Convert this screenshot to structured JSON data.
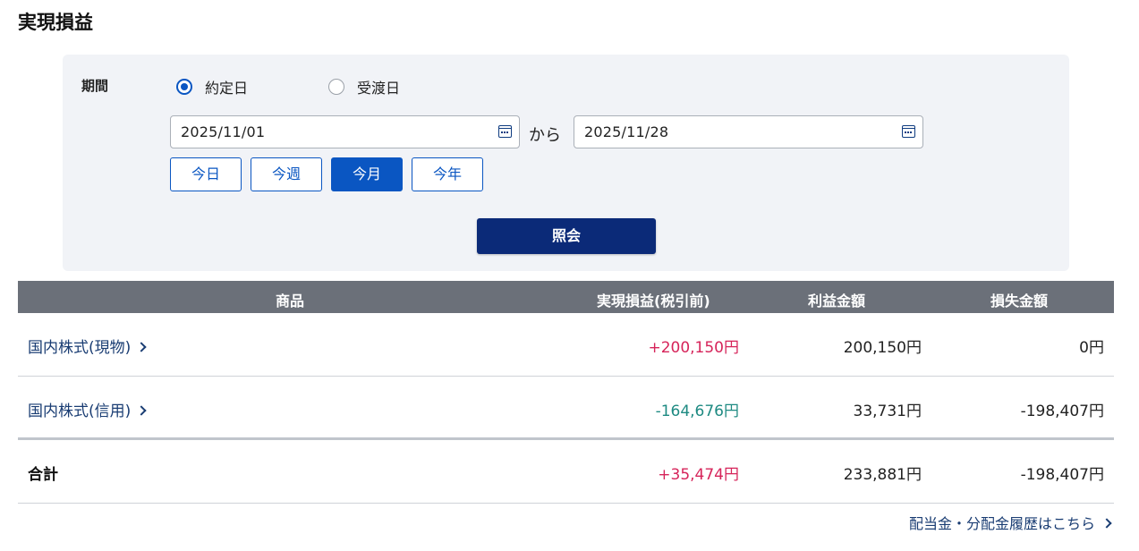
{
  "page": {
    "title": "実現損益"
  },
  "filter": {
    "period_label": "期間",
    "radios": [
      {
        "label": "約定日",
        "checked": true
      },
      {
        "label": "受渡日",
        "checked": false
      }
    ],
    "date_from": "2025/11/01",
    "date_to": "2025/11/28",
    "connector": "から",
    "quick_buttons": [
      {
        "label": "今日",
        "active": false
      },
      {
        "label": "今週",
        "active": false
      },
      {
        "label": "今月",
        "active": true
      },
      {
        "label": "今年",
        "active": false
      }
    ],
    "submit_label": "照会"
  },
  "table": {
    "headers": {
      "product": "商品",
      "pnl": "実現損益(税引前)",
      "profit": "利益金額",
      "loss": "損失金額"
    },
    "rows": [
      {
        "product": "国内株式(現物)",
        "pnl": "+200,150円",
        "profit": "200,150円",
        "loss": "0円"
      },
      {
        "product": "国内株式(信用)",
        "pnl": "-164,676円",
        "profit": "33,731円",
        "loss": "-198,407円"
      }
    ],
    "total": {
      "label": "合計",
      "pnl": "+35,474円",
      "profit": "233,881円",
      "loss": "-198,407円"
    }
  },
  "footer": {
    "link_label": "配当金・分配金履歴はこちら"
  },
  "colors": {
    "accent": "#0a56c2",
    "submit": "#0b2a78",
    "positive": "#d6245a",
    "negative": "#1e8a82",
    "header_bg": "#6b7079"
  }
}
